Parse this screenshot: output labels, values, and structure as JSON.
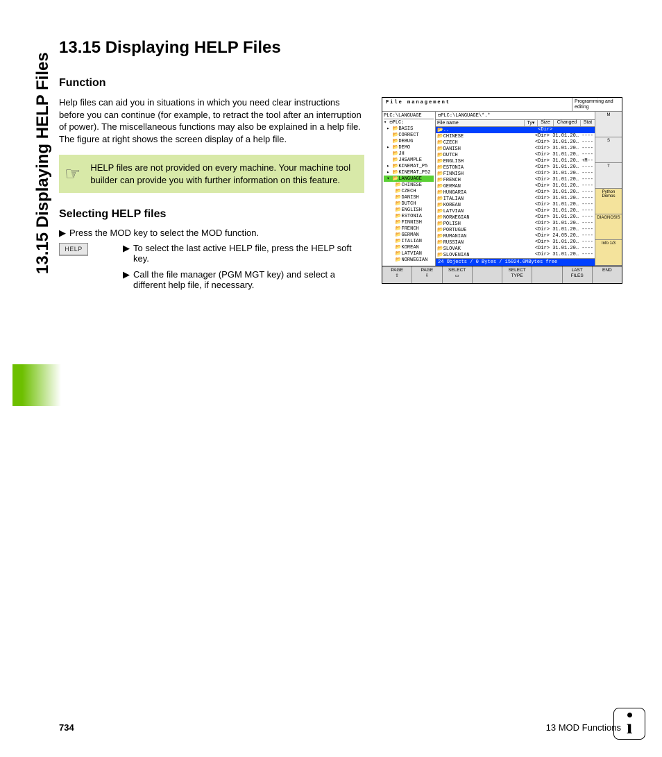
{
  "tab_title": "13.15 Displaying HELP Files",
  "heading": "13.15 Displaying HELP Files",
  "h2_function": "Function",
  "p_function": "Help files can aid you in situations in which you need clear instructions before you can continue (for example, to retract the tool after an interruption of power). The miscellaneous functions may also be explained in a help file. The figure at right shows the screen display of a help file.",
  "note_text": "HELP files are not provided on every machine. Your machine tool builder can provide you with further information on this feature.",
  "h2_select": "Selecting HELP files",
  "step1": "Press the MOD key to select the MOD function.",
  "help_key": "HELP",
  "step2": "To select the last active HELP file, press the HELP soft key.",
  "step3": "Call the file manager (PGM MGT key) and select a different help file, if necessary.",
  "shot": {
    "title": "File management",
    "mode": "Programming and editing",
    "path_left": "PLC:\\LANGUAGE",
    "tree": [
      "▾ ⊟PLC:",
      " ▸ 📂BASIS",
      "   📂CORRECT",
      "   📂DEBUG",
      " ▸ 📂DEMO",
      "   📂JH",
      "   📂JHSAMPLE",
      " ▸ 📂KINEMAT_P5",
      " ▸ 📂KINEMAT_P52"
    ],
    "tree_sel": " ▾ 📂LANGUAGE",
    "tree2": [
      "    📂CHINESE",
      "    📂CZECH",
      "    📂DANISH",
      "    📂DUTCH",
      "    📂ENGLISH",
      "    📂ESTONIA",
      "    📂FINNISH",
      "    📂FRENCH",
      "    📂GERMAN",
      "    📂ITALIAN",
      "    📂KOREAN",
      "    📂LATVIAN",
      "    📂NORWEGIAN"
    ],
    "list_path": "⊟PLC:\\LANGUAGE\\*.*",
    "hdr": [
      "File name",
      "Ty▾",
      "Size",
      "Changed",
      "Stat"
    ],
    "rows": [
      {
        "n": "📂..",
        "d": "<Dir>              ",
        "hi": true
      },
      {
        "n": "📂CHINESE",
        "d": "<Dir> 31.01.20… ----"
      },
      {
        "n": "📂CZECH",
        "d": "<Dir> 31.01.20… ----"
      },
      {
        "n": "📂DANISH",
        "d": "<Dir> 31.01.20… ----"
      },
      {
        "n": "📂DUTCH",
        "d": "<Dir> 31.01.20… ----"
      },
      {
        "n": "📂ENGLISH",
        "d": "<Dir> 31.01.20… +M--"
      },
      {
        "n": "📂ESTONIA",
        "d": "<Dir> 31.01.20… ----"
      },
      {
        "n": "📂FINNISH",
        "d": "<Dir> 31.01.20… ----"
      },
      {
        "n": "📂FRENCH",
        "d": "<Dir> 31.01.20… ----"
      },
      {
        "n": "📂GERMAN",
        "d": "<Dir> 31.01.20… ----"
      },
      {
        "n": "📂HUNGARIA",
        "d": "<Dir> 31.01.20… ----"
      },
      {
        "n": "📂ITALIAN",
        "d": "<Dir> 31.01.20… ----"
      },
      {
        "n": "📂KOREAN",
        "d": "<Dir> 31.01.20… ----"
      },
      {
        "n": "📂LATVIAN",
        "d": "<Dir> 31.01.20… ----"
      },
      {
        "n": "📂NORWEGIAN",
        "d": "<Dir> 31.01.20… ----"
      },
      {
        "n": "📂POLISH",
        "d": "<Dir> 31.01.20… ----"
      },
      {
        "n": "📂PORTUGUE",
        "d": "<Dir> 31.01.20… ----"
      },
      {
        "n": "📂RUMANIAN",
        "d": "<Dir> 24.05.20… ----"
      },
      {
        "n": "📂RUSSIAN",
        "d": "<Dir> 31.01.20… ----"
      },
      {
        "n": "📂SLOVAK",
        "d": "<Dir> 31.01.20… ----"
      },
      {
        "n": "📂SLOVENIAN",
        "d": "<Dir> 31.01.20… ----"
      }
    ],
    "status": "24 Objects / 0 Bytes / 15024.0MBytes free",
    "side": [
      {
        "t": "M",
        "cls": ""
      },
      {
        "t": "S",
        "cls": ""
      },
      {
        "t": "T",
        "cls": ""
      },
      {
        "t": "Python\nDemos",
        "cls": "ylw"
      },
      {
        "t": "DIAGNOSIS",
        "cls": "ylw"
      },
      {
        "t": "Info 1/3",
        "cls": "ylw"
      }
    ],
    "soft": [
      "PAGE\n⇧",
      "PAGE\n⇩",
      "SELECT\n▭",
      "",
      "SELECT\nTYPE",
      "",
      "LAST\nFILES",
      "END"
    ]
  },
  "footer_page": "734",
  "footer_chapter": "13 MOD Functions"
}
